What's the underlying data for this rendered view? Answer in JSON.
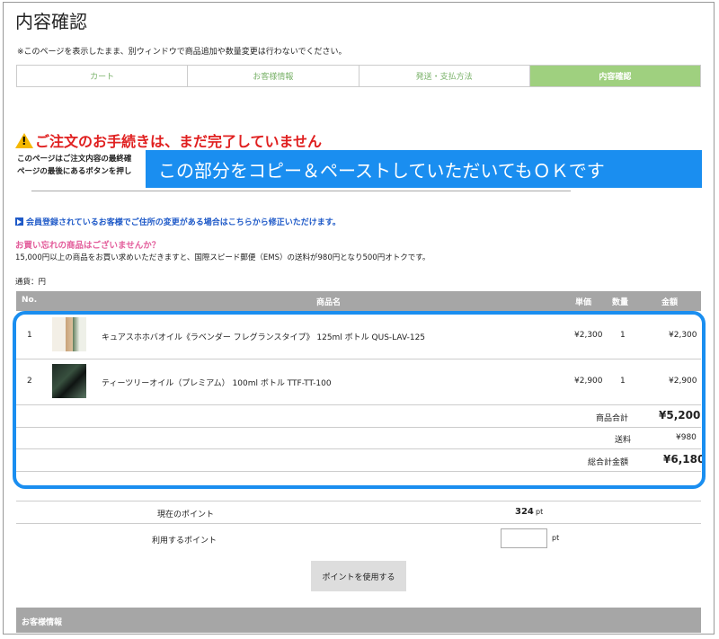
{
  "page": {
    "title": "内容確認",
    "notice": "※このページを表示したまま、別ウィンドウで商品追加や数量変更は行わないでください。"
  },
  "steps": [
    {
      "label": "カート"
    },
    {
      "label": "お客様情報"
    },
    {
      "label": "発送・支払方法"
    },
    {
      "label": "内容確認"
    }
  ],
  "warning": {
    "title": "ご注文のお手続きは、まだ完了していません",
    "line1": "このページはご注文内容の最終確",
    "line2": "ページの最後にあるボタンを押し"
  },
  "callout": "この部分をコピー＆ペーストしていただいてもＯＫです",
  "member_link": "会員登録されているお客様でご住所の変更がある場合はこちらから修正いただけます。",
  "forgot": "お買い忘れの商品はございませんか？",
  "ems_note": "15,000円以上の商品をお買い求めいただきますと、国際スピード郵便（EMS）の送料が980円となり500円オトクです。",
  "currency": "通貨：円",
  "table": {
    "headers": {
      "no": "No.",
      "name": "商品名",
      "price": "単価",
      "qty": "数量",
      "amount": "金額"
    },
    "rows": [
      {
        "no": "1",
        "name": "キュアスホホバオイル《ラベンダー フレグランスタイプ》 125ml ボトル QUS-LAV-125",
        "price": "¥2,300",
        "qty": "1",
        "amount": "¥2,300"
      },
      {
        "no": "2",
        "name": "ティーツリーオイル（プレミアム） 100ml ボトル TTF-TT-100",
        "price": "¥2,900",
        "qty": "1",
        "amount": "¥2,900"
      }
    ],
    "subtotal_label": "商品合計",
    "subtotal_value": "¥5,200",
    "shipping_label": "送料",
    "shipping_value": "¥980",
    "total_label": "総合計金額",
    "total_value": "¥6,180"
  },
  "points": {
    "current_label": "現在のポイント",
    "current_value": "324",
    "unit": "pt",
    "use_label": "利用するポイント",
    "input_value": "",
    "button": "ポイントを使用する"
  },
  "customer_section": "お客様情報",
  "colors": {
    "callout": "#1a8ef0",
    "active_step": "#9fd07f",
    "warning": "#e02020",
    "pink": "#e35d9b",
    "link": "#1f5ac8"
  }
}
